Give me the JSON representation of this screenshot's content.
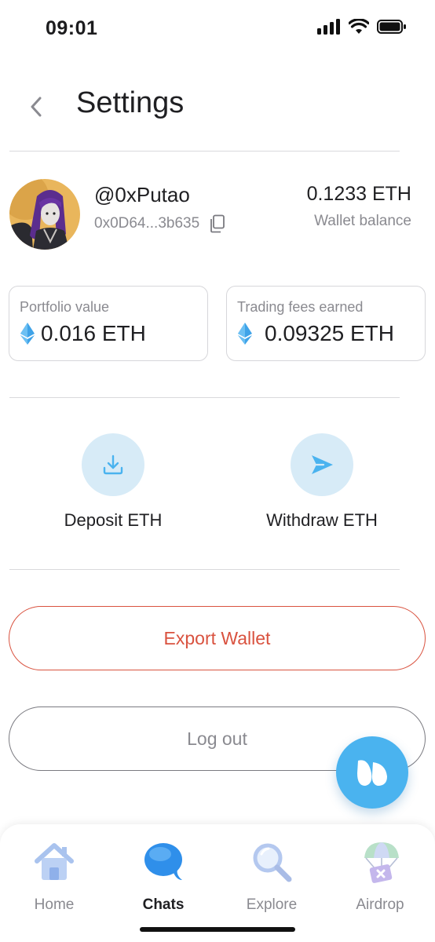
{
  "status_bar": {
    "time": "09:01"
  },
  "header": {
    "title": "Settings"
  },
  "profile": {
    "username": "@0xPutao",
    "address": "0x0D64...3b635",
    "balance": "0.1233 ETH",
    "balance_label": "Wallet balance"
  },
  "stats": {
    "portfolio": {
      "label": "Portfolio value",
      "value": "0.016 ETH"
    },
    "fees": {
      "label": "Trading fees earned",
      "value": "0.09325 ETH"
    }
  },
  "actions": {
    "deposit": {
      "label": "Deposit ETH",
      "icon": "download-icon"
    },
    "withdraw": {
      "label": "Withdraw ETH",
      "icon": "send-icon"
    }
  },
  "buttons": {
    "export": "Export Wallet",
    "logout": "Log out"
  },
  "tabbar": {
    "items": [
      {
        "label": "Home",
        "icon": "house-icon",
        "active": false
      },
      {
        "label": "Chats",
        "icon": "chat-bubble-icon",
        "active": true
      },
      {
        "label": "Explore",
        "icon": "magnifier-icon",
        "active": false
      },
      {
        "label": "Airdrop",
        "icon": "parachute-gift-icon",
        "active": false
      }
    ]
  },
  "colors": {
    "accent": "#4ab3ef",
    "action_bg": "#d7ebf7",
    "danger": "#d9523f",
    "eth": "#3fa3e8"
  }
}
